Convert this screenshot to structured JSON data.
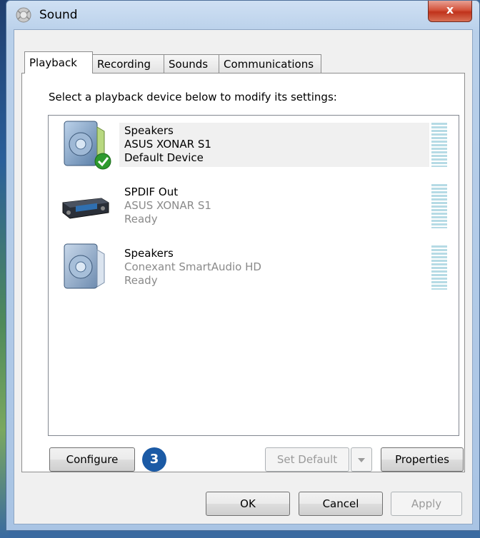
{
  "window": {
    "title": "Sound",
    "close_label": "x"
  },
  "tabs": [
    {
      "label": "Playback",
      "active": true
    },
    {
      "label": "Recording",
      "active": false
    },
    {
      "label": "Sounds",
      "active": false
    },
    {
      "label": "Communications",
      "active": false
    }
  ],
  "instruction": "Select a playback device below to modify its settings:",
  "devices": [
    {
      "name": "Speakers",
      "driver": "ASUS XONAR S1",
      "status": "Default Device",
      "icon": "speaker-icon",
      "selected": true,
      "default": true
    },
    {
      "name": "SPDIF Out",
      "driver": "ASUS XONAR S1",
      "status": "Ready",
      "icon": "digital-receiver-icon",
      "selected": false
    },
    {
      "name": "Speakers",
      "driver": "Conexant SmartAudio HD",
      "status": "Ready",
      "icon": "speaker-icon",
      "selected": false
    }
  ],
  "buttons": {
    "configure": "Configure",
    "badge": "3",
    "set_default": "Set Default",
    "properties": "Properties",
    "ok": "OK",
    "cancel": "Cancel",
    "apply": "Apply"
  }
}
